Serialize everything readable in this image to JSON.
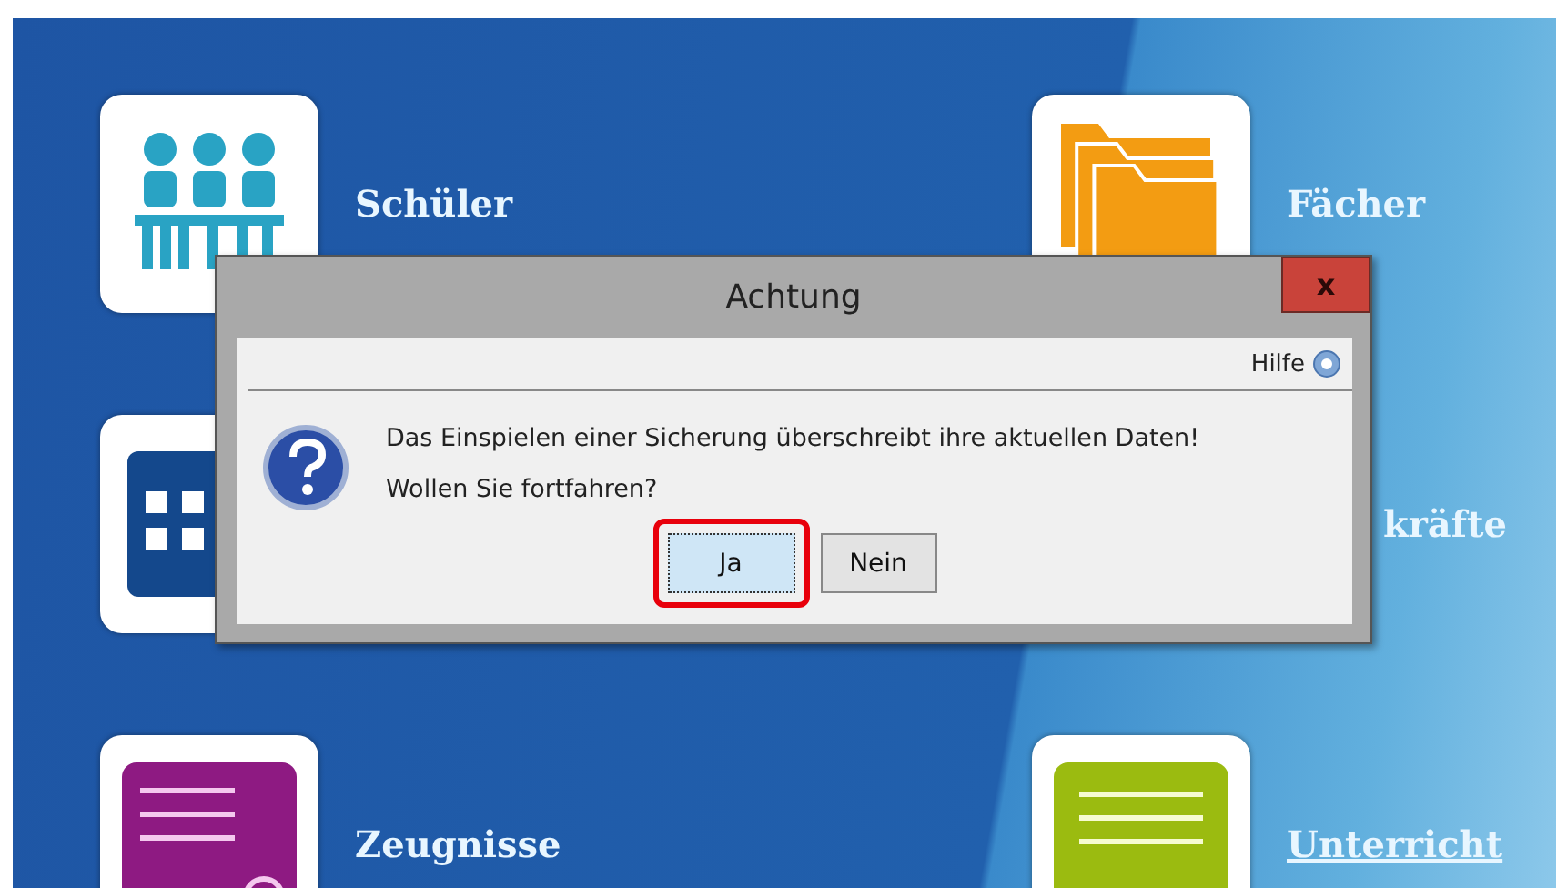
{
  "tiles": [
    {
      "kind": "people",
      "label": "Schüler"
    },
    {
      "kind": "folders",
      "label": "Fächer"
    },
    {
      "kind": "grid"
    },
    {
      "kind": "covered",
      "label": "kräfte"
    },
    {
      "kind": "certificate",
      "label": "Zeugnisse"
    },
    {
      "kind": "lines",
      "label": "Unterricht",
      "link": true
    }
  ],
  "dialog": {
    "title": "Achtung",
    "close": "x",
    "help": "Hilfe",
    "message": [
      "Das Einspielen einer Sicherung überschreibt ihre aktuellen Daten!",
      "Wollen Sie fortfahren?"
    ],
    "buttons": [
      {
        "label": "Ja",
        "focused": true,
        "highlighted": true
      },
      {
        "label": "Nein",
        "focused": false
      }
    ]
  }
}
